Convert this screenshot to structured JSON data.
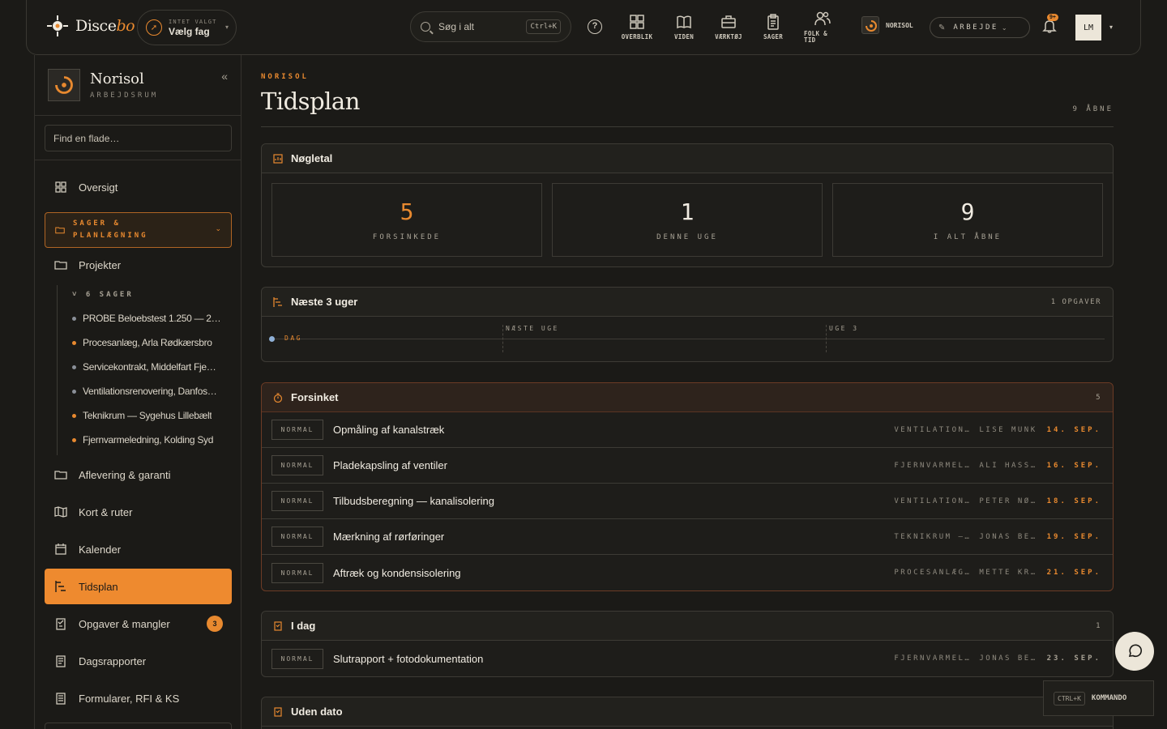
{
  "topbar": {
    "logo": {
      "text_a": "Disce",
      "text_b": "bo"
    },
    "fag": {
      "small": "INTET VALGT",
      "big": "Vælg fag"
    },
    "search": {
      "placeholder": "Søg i alt",
      "shortcut": "Ctrl+K"
    },
    "nav": [
      {
        "label": "OVERBLIK",
        "icon": "grid-icon"
      },
      {
        "label": "VIDEN",
        "icon": "book-icon"
      },
      {
        "label": "VÆRKTØJ",
        "icon": "briefcase-icon"
      },
      {
        "label": "SAGER",
        "icon": "clipboard-icon"
      },
      {
        "label_1": "FOLK &",
        "label_2": "TID",
        "icon": "people-icon"
      }
    ],
    "org": "NORISOL",
    "mode": "ARBEJDE",
    "notifications": "9+",
    "avatar": "LM"
  },
  "sidebar": {
    "workspace_name": "Norisol",
    "workspace_sub": "ARBEJDSRUM",
    "find_placeholder": "Find en flade…",
    "items": {
      "oversigt": "Oversigt",
      "group_line1": "SAGER &",
      "group_line2": "PLANLÆGNING",
      "projekter": "Projekter",
      "aflevering": "Aflevering & garanti",
      "kort": "Kort & ruter",
      "kalender": "Kalender",
      "tidsplan": "Tidsplan",
      "opgaver": "Opgaver & mangler",
      "opgaver_count": "3",
      "dagsrapporter": "Dagsrapporter",
      "formularer": "Formularer, RFI & KS"
    },
    "cases_head": "6 SAGER",
    "cases": [
      {
        "name": "PROBE Beloebstest 1.250 — 2…",
        "color": "#8a8f98"
      },
      {
        "name": "Procesanlæg, Arla Rødkærsbro",
        "color": "#e8892f"
      },
      {
        "name": "Servicekontrakt, Middelfart Fje…",
        "color": "#8a8f98"
      },
      {
        "name": "Ventilationsrenovering, Danfos…",
        "color": "#8a8f98"
      },
      {
        "name": "Teknikrum — Sygehus Lillebælt",
        "color": "#e8892f"
      },
      {
        "name": "Fjernvarmeledning, Kolding Syd",
        "color": "#e8892f"
      }
    ]
  },
  "main": {
    "crumb": "NORISOL",
    "title": "Tidsplan",
    "open_count": "9 ÅBNE",
    "kpi_panel": {
      "title": "Nøgletal",
      "kpis": [
        {
          "value": "5",
          "label": "FORSINKEDE"
        },
        {
          "value": "1",
          "label": "DENNE UGE"
        },
        {
          "value": "9",
          "label": "I ALT ÅBNE"
        }
      ]
    },
    "next_panel": {
      "title": "Næste 3 uger",
      "count": "1 OPGAVER",
      "today": "DAG",
      "weeks": [
        "NÆSTE UGE",
        "UGE 3"
      ]
    },
    "late_panel": {
      "title": "Forsinket",
      "count": "5",
      "rows": [
        {
          "priority": "NORMAL",
          "name": "Opmåling af kanalstræk",
          "project": "VENTILATION…",
          "person": "LISE MUNK",
          "date": "14. SEP."
        },
        {
          "priority": "NORMAL",
          "name": "Pladekapsling af ventiler",
          "project": "FJERNVARMEL…",
          "person": "ALI HASS…",
          "date": "16. SEP."
        },
        {
          "priority": "NORMAL",
          "name": "Tilbudsberegning — kanalisolering",
          "project": "VENTILATION…",
          "person": "PETER NØ…",
          "date": "18. SEP."
        },
        {
          "priority": "NORMAL",
          "name": "Mærkning af rørføringer",
          "project": "TEKNIKRUM —…",
          "person": "JONAS BE…",
          "date": "19. SEP."
        },
        {
          "priority": "NORMAL",
          "name": "Aftræk og kondensisolering",
          "project": "PROCESANLÆG…",
          "person": "METTE KR…",
          "date": "21. SEP."
        }
      ]
    },
    "today_panel": {
      "title": "I dag",
      "count": "1",
      "rows": [
        {
          "priority": "NORMAL",
          "name": "Slutrapport + fotodokumentation",
          "project": "FJERNVARMEL…",
          "person": "JONAS BE…",
          "date": "23. SEP."
        }
      ]
    },
    "nodate_panel": {
      "title": "Uden dato"
    }
  },
  "command_hint": {
    "key": "CTRL+K",
    "label": "KOMMANDO"
  },
  "colors": {
    "accent": "#e8892f",
    "background": "#1b1a17"
  }
}
